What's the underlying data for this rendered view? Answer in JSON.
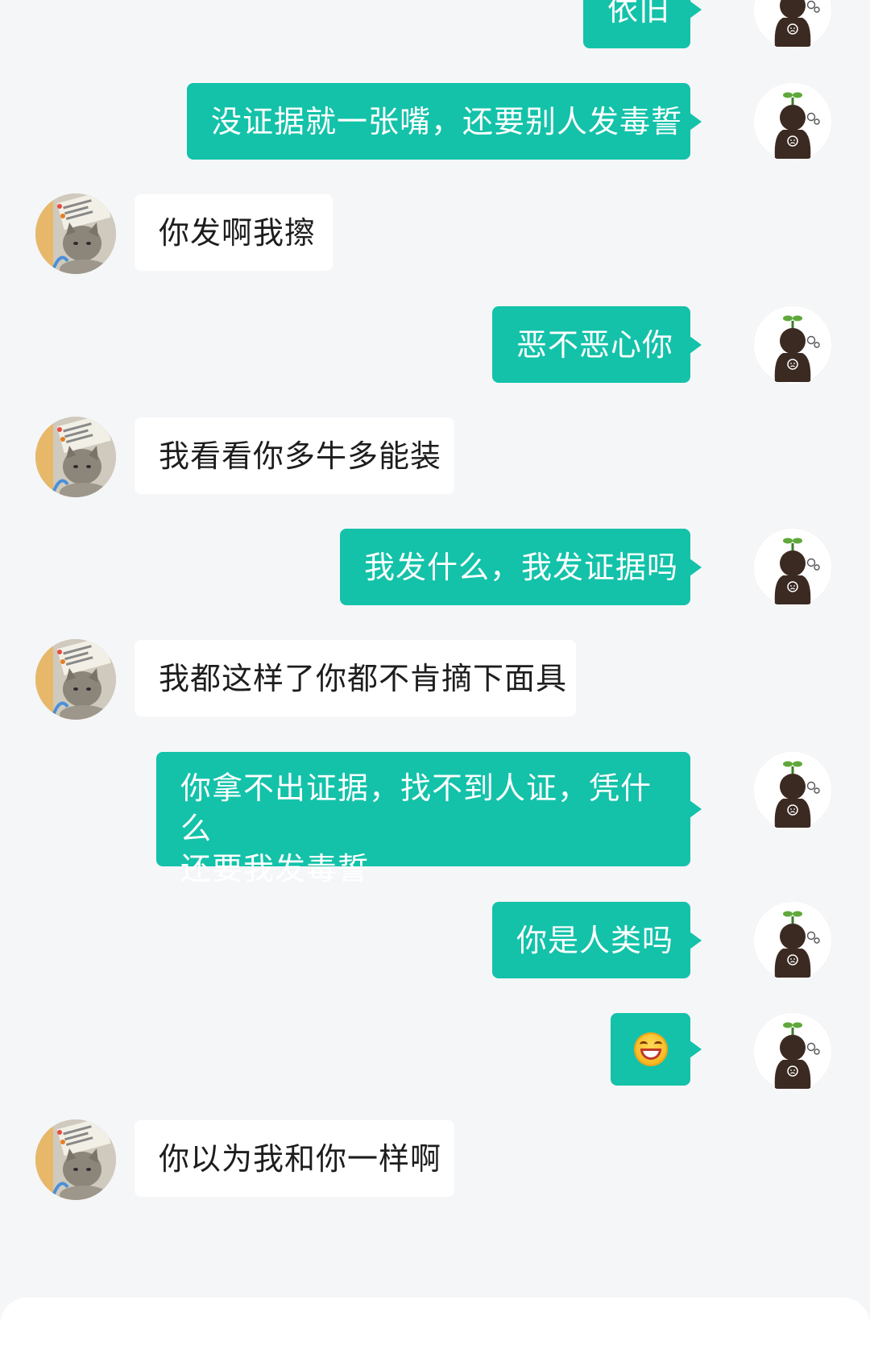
{
  "messages": [
    {
      "side": "self",
      "text": "依旧"
    },
    {
      "side": "self",
      "text": "没证据就一张嘴，还要别人发毒誓"
    },
    {
      "side": "other",
      "text": "你发啊我擦"
    },
    {
      "side": "self",
      "text": "恶不恶心你"
    },
    {
      "side": "other",
      "text": "我看看你多牛多能装"
    },
    {
      "side": "self",
      "text": "我发什么，我发证据吗"
    },
    {
      "side": "other",
      "text": "我都这样了你都不肯摘下面具"
    },
    {
      "side": "self",
      "text_line1": "你拿不出证据，找不到人证，凭什么",
      "text_line2": "还要我发毒誓"
    },
    {
      "side": "self",
      "text": "你是人类吗"
    },
    {
      "side": "self",
      "emoji": "grinning-squint-face-emoji"
    },
    {
      "side": "other",
      "text": "你以为我和你一样啊"
    }
  ],
  "colors": {
    "self_bubble": "#13c2a9",
    "other_bubble": "#ffffff",
    "background": "#f5f6f8"
  },
  "icons": {
    "self_avatar": "sprout-head-avatar",
    "other_avatar": "cat-photo-avatar"
  }
}
